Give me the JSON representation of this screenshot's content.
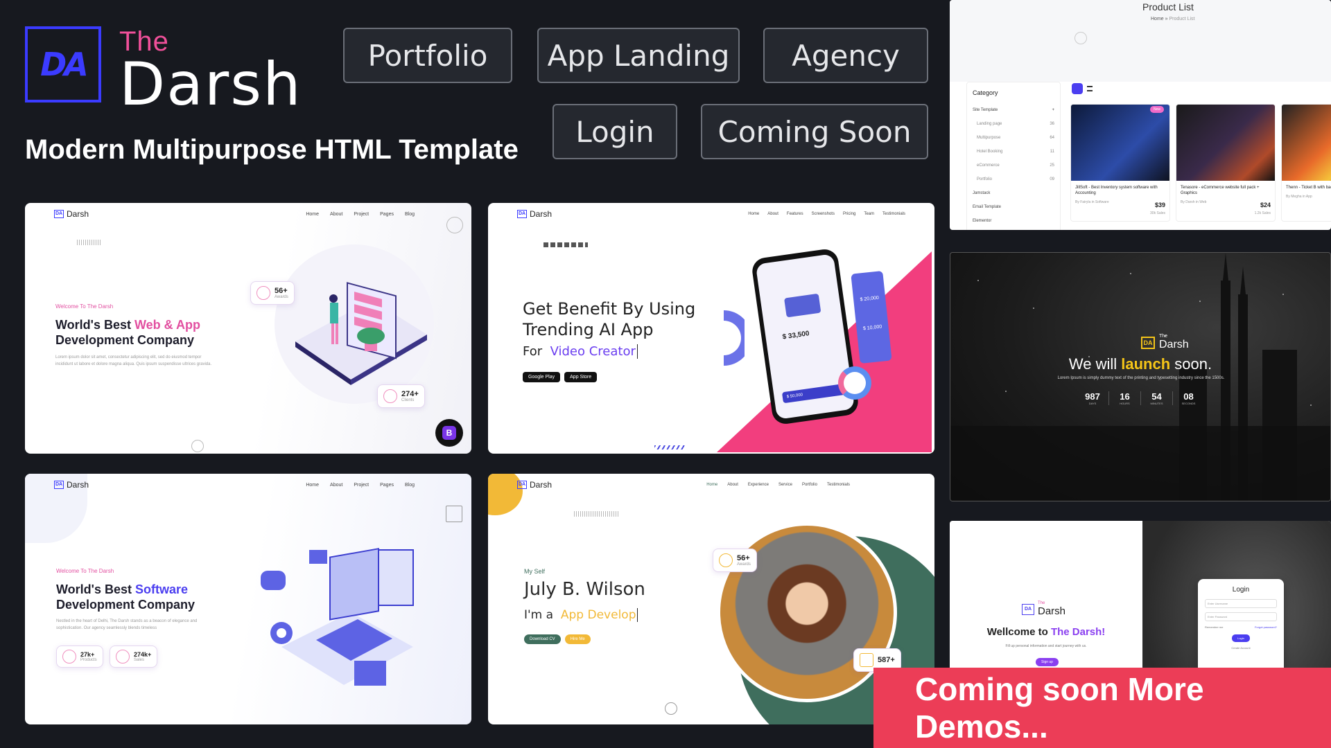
{
  "brand": {
    "logo_text": "DA",
    "the": "The",
    "name": "Darsh",
    "tagline": "Modern Multipurpose HTML Template"
  },
  "nav": {
    "portfolio": "Portfolio",
    "app_landing": "App Landing",
    "agency": "Agency",
    "login": "Login",
    "coming_soon": "Coming Soon"
  },
  "demo1": {
    "logo": "Darsh",
    "links": [
      "Home",
      "About",
      "Project",
      "Pages",
      "Blog"
    ],
    "welcome": "Welcome To The Darsh",
    "title_a": "World's Best ",
    "title_b": "Web & App",
    "title_c": "Development Company",
    "body": "Lorem ipsum dolor sit amet, consectetur adipiscing elit, sed do eiusmod tempor incididunt ut labore et dolore magna aliqua. Quis ipsum suspendisse ultrices gravida.",
    "stat1_val": "56+",
    "stat1_lbl": "Awards",
    "stat2_val": "274+",
    "stat2_lbl": "Clients",
    "badge": "B"
  },
  "demo2": {
    "logo": "Darsh",
    "links": [
      "Home",
      "About",
      "Features",
      "Screenshots",
      "Pricing",
      "Team",
      "Testimonials"
    ],
    "title_a": "Get Benefit By Using",
    "title_b": "Trending AI App",
    "for": "For",
    "role": "Video Creator",
    "google": "Google Play",
    "apple": "App Store",
    "balance": "$ 33,500",
    "card1": "$ 20,000",
    "card2": "$ 10,000",
    "small": "$ 50,000"
  },
  "demo3": {
    "logo": "Darsh",
    "links": [
      "Home",
      "About",
      "Project",
      "Pages",
      "Blog"
    ],
    "welcome": "Welcome To The Darsh",
    "title_a": "World's Best ",
    "title_b": "Software",
    "title_c": "Development Company",
    "body": "Nestled in the heart of Delhi, The Darsh stands as a beacon of elegance and sophistication. Our agency seamlessly blends timeless",
    "stat1_val": "27k+",
    "stat1_lbl": "Products",
    "stat2_val": "274k+",
    "stat2_lbl": "Sales"
  },
  "demo4": {
    "logo": "Darsh",
    "links": [
      "Home",
      "About",
      "Experience",
      "Service",
      "Portfolio",
      "Testimonials"
    ],
    "myself": "My Self",
    "name": "July B. Wilson",
    "im": "I'm a",
    "role": "App Develop",
    "btn1": "Download CV",
    "btn2": "Hire Me",
    "stat1_val": "56+",
    "stat1_lbl": "Awards",
    "stat2_val": "587+"
  },
  "product_list": {
    "title": "Product List",
    "crumb_home": "Home",
    "crumb_current": "Product List",
    "category": "Category",
    "cats": [
      "Site Template",
      "Landing page",
      "Multipurpose",
      "Hotel Booking",
      "eCommerce",
      "Portfolio",
      "Jamstack",
      "Email Template",
      "Elementor"
    ],
    "counts": [
      "36",
      "64",
      "11",
      "25",
      "09"
    ],
    "products": [
      {
        "name": "JillSoft - Best Inventory system software with Accounting",
        "by": "By Fairyla in Software",
        "price": "$39",
        "sales": "30k Sales"
      },
      {
        "name": "Tenasore - eCommerce website full pack + Graphics",
        "by": "By Darsh in Web",
        "price": "$24",
        "sales": "1.2k Sales"
      },
      {
        "name": "Thenn - Ticket B with backend",
        "by": "By Megha in App",
        "price": "",
        "sales": ""
      }
    ],
    "ribbon": "New"
  },
  "coming": {
    "the": "The",
    "name": "Darsh",
    "title_a": "We will ",
    "title_b": "launch",
    "title_c": " soon.",
    "body": "Lorem Ipsum is simply dummy text of the printing and typesetting industry since the 1500s.",
    "counters": [
      {
        "v": "987",
        "l": "DAYS"
      },
      {
        "v": "16",
        "l": "HOURS"
      },
      {
        "v": "54",
        "l": "MINUTES"
      },
      {
        "v": "08",
        "l": "SECONDS"
      }
    ]
  },
  "login": {
    "the": "The",
    "name": "Darsh",
    "welcome_a": "Wellcome to ",
    "welcome_b": "The Darsh!",
    "sub": "Fill up personal information and start journey with us.",
    "signup": "Sign up",
    "title": "Login",
    "username": "Enter Username",
    "password": "Enter Password",
    "remember": "Remember me",
    "forgot": "Forgot password?",
    "button": "Login",
    "create": "Create Account"
  },
  "banner": "Coming soon More Demos..."
}
